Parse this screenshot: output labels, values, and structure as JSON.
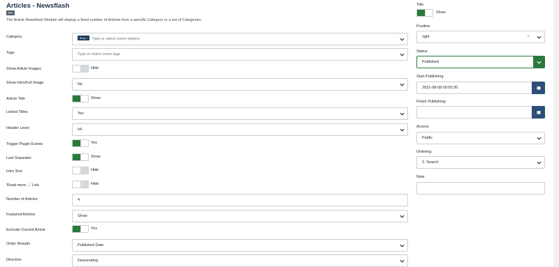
{
  "header": {
    "title": "Articles - Newsflash",
    "site_badge": "Site",
    "description": "The Article Newsflash Module will display a fixed number of Articles from a specific Category or a set of Categories."
  },
  "form": {
    "category": {
      "label": "Category",
      "tag": "Blog",
      "tag_close": "×",
      "placeholder": "Type or select some options"
    },
    "tags": {
      "label": "Tags",
      "placeholder": "Type or select some tags"
    },
    "show_article_images": {
      "label": "Show Article Images",
      "state": "Hide",
      "on": false
    },
    "show_intro_full_image": {
      "label": "Show Intro/Full Image",
      "value": "No"
    },
    "article_title": {
      "label": "Article Title",
      "state": "Show",
      "on": true
    },
    "linked_titles": {
      "label": "Linked Titles",
      "value": "Yes"
    },
    "header_level": {
      "label": "Header Level",
      "value": "h4"
    },
    "trigger_plugin_events": {
      "label": "Trigger Plugin Events",
      "state": "Yes",
      "on": true
    },
    "last_separator": {
      "label": "Last Separator",
      "state": "Show",
      "on": true
    },
    "intro_text": {
      "label": "Intro Text",
      "state": "Hide",
      "on": false
    },
    "read_more_link": {
      "label": "'Read more ...' Link",
      "state": "Hide",
      "on": false
    },
    "number_of_articles": {
      "label": "Number of Articles",
      "value": "4"
    },
    "featured_articles": {
      "label": "Featured Articles",
      "value": "Show"
    },
    "exclude_current_article": {
      "label": "Exclude Current Article",
      "state": "Yes",
      "on": true
    },
    "order_results": {
      "label": "Order Results",
      "value": "Published Date"
    },
    "direction": {
      "label": "Direction",
      "value": "Descending"
    }
  },
  "sidebar": {
    "title": {
      "label": "Title",
      "state": "Show",
      "on": true
    },
    "position": {
      "label": "Position",
      "value": "right",
      "clear": "×"
    },
    "status": {
      "label": "Status",
      "value": "Published"
    },
    "start_publishing": {
      "label": "Start Publishing",
      "value": "2021-08-08 09:55:30"
    },
    "finish_publishing": {
      "label": "Finish Publishing",
      "value": ""
    },
    "access": {
      "label": "Access",
      "value": "Public"
    },
    "ordering": {
      "label": "Ordering",
      "value": "2. Search"
    },
    "note": {
      "label": "Note",
      "value": ""
    }
  },
  "colors": {
    "toggle_on": "#2a7a3b",
    "calendar_button": "#2c4e78",
    "title_text": "#1c2f4a"
  }
}
